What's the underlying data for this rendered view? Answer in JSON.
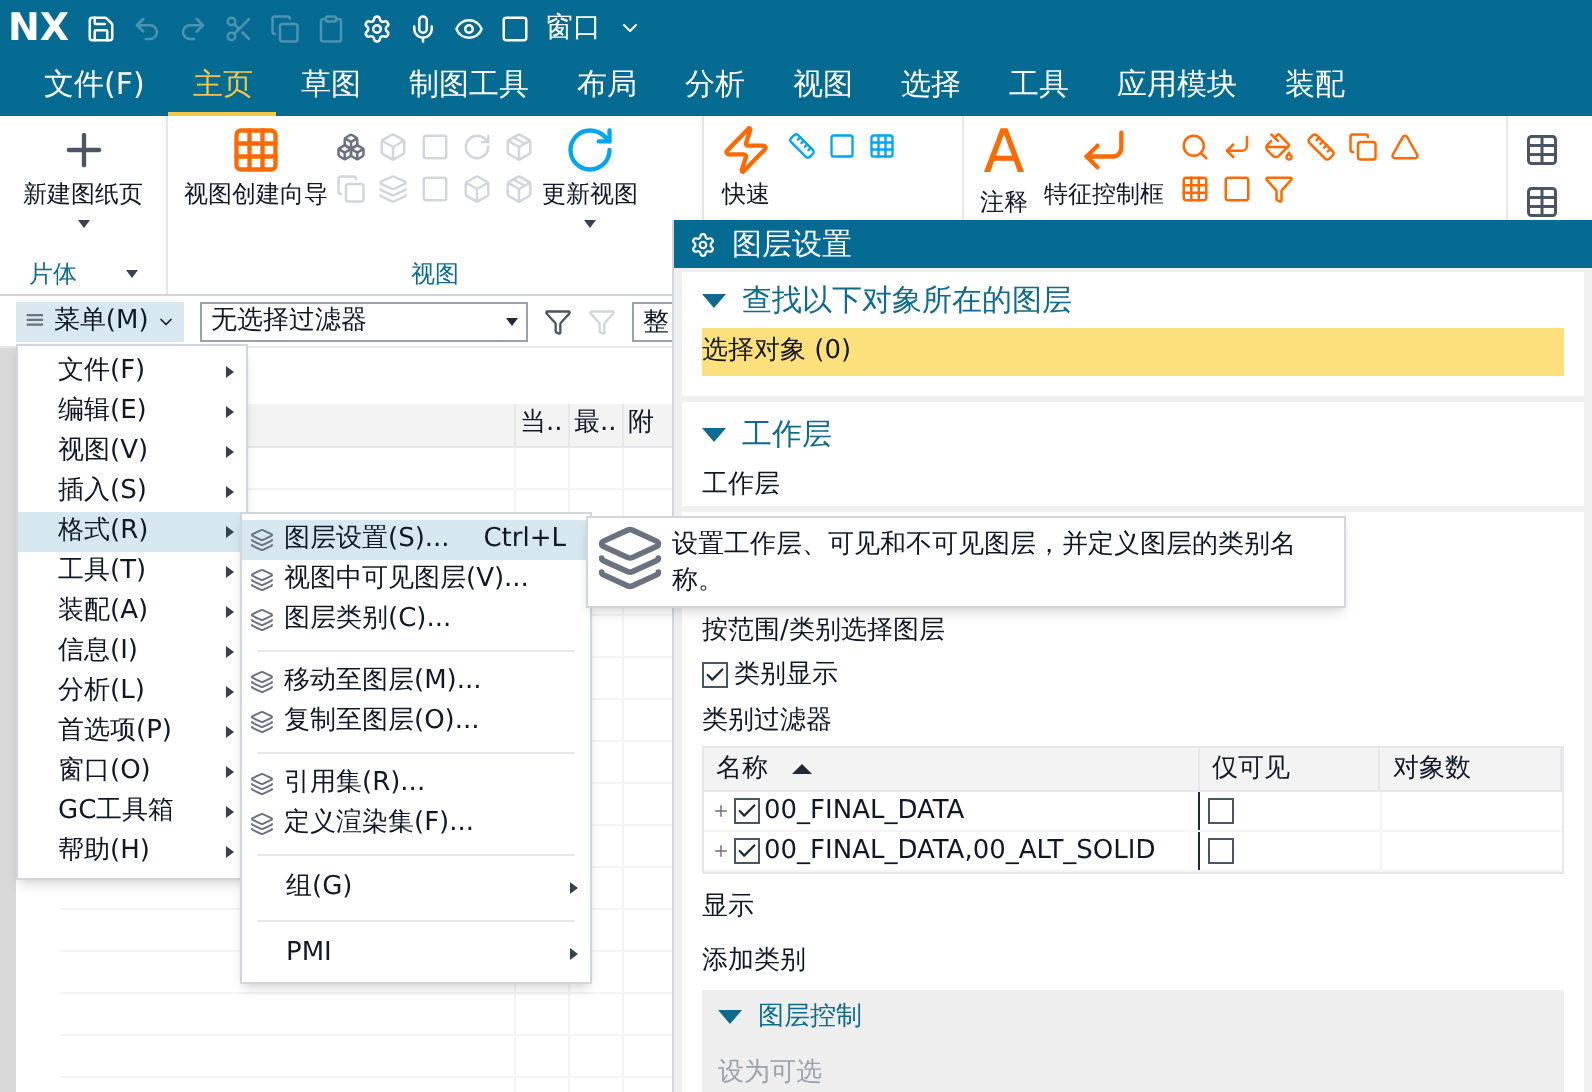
{
  "title_bar": {
    "logo": "NX",
    "window_menu": "窗口"
  },
  "tabs": [
    {
      "label": "文件(F)",
      "selected": false
    },
    {
      "label": "主页",
      "selected": true
    },
    {
      "label": "草图",
      "selected": false
    },
    {
      "label": "制图工具",
      "selected": false
    },
    {
      "label": "布局",
      "selected": false
    },
    {
      "label": "分析",
      "selected": false
    },
    {
      "label": "视图",
      "selected": false
    },
    {
      "label": "选择",
      "selected": false
    },
    {
      "label": "工具",
      "selected": false
    },
    {
      "label": "应用模块",
      "selected": false
    },
    {
      "label": "装配",
      "selected": false
    }
  ],
  "ribbon": {
    "sheet_group": {
      "label": "片体",
      "button": "新建图纸页"
    },
    "view_group": {
      "label": "视图",
      "wizard_button": "视图创建向导",
      "update_button": "更新视图"
    },
    "quick_button": "快速",
    "note_glyph": "A",
    "note_button": "注释",
    "fcf_button": "特征控制框"
  },
  "toolbar": {
    "menu_glyph": "≡",
    "menu_button": "菜单(M)",
    "filter": "无选择过滤器",
    "scope_field": "整"
  },
  "canvas_table": {
    "columns": [
      "当..",
      "最..",
      "附"
    ]
  },
  "main_menu": {
    "items": [
      {
        "label": "文件(F)",
        "selected": false
      },
      {
        "label": "编辑(E)",
        "selected": false
      },
      {
        "label": "视图(V)",
        "selected": false
      },
      {
        "label": "插入(S)",
        "selected": false
      },
      {
        "label": "格式(R)",
        "selected": true
      },
      {
        "label": "工具(T)",
        "selected": false
      },
      {
        "label": "装配(A)",
        "selected": false
      },
      {
        "label": "信息(I)",
        "selected": false
      },
      {
        "label": "分析(L)",
        "selected": false
      },
      {
        "label": "首选项(P)",
        "selected": false
      },
      {
        "label": "窗口(O)",
        "selected": false
      },
      {
        "label": "GC工具箱",
        "selected": false
      },
      {
        "label": "帮助(H)",
        "selected": false
      }
    ]
  },
  "format_submenu": {
    "items": [
      {
        "kind": "command",
        "label": "图层设置(S)...",
        "shortcut": "Ctrl+L",
        "selected": true
      },
      {
        "kind": "command",
        "label": "视图中可见图层(V)...",
        "selected": false
      },
      {
        "kind": "command",
        "label": "图层类别(C)...",
        "selected": false
      },
      {
        "kind": "divider"
      },
      {
        "kind": "command",
        "label": "移动至图层(M)...",
        "selected": false
      },
      {
        "kind": "command",
        "label": "复制至图层(O)...",
        "selected": false
      },
      {
        "kind": "divider"
      },
      {
        "kind": "command",
        "label": "引用集(R)...",
        "selected": false
      },
      {
        "kind": "command",
        "label": "定义渲染集(F)...",
        "selected": false
      },
      {
        "kind": "divider"
      },
      {
        "kind": "submenu",
        "label": "组(G)",
        "selected": false
      },
      {
        "kind": "divider"
      },
      {
        "kind": "submenu",
        "label": "PMI",
        "selected": false
      }
    ]
  },
  "tooltip": {
    "text": "设置工作层、可见和不可见图层，并定义图层的类别名称。"
  },
  "dialog": {
    "title": "图层设置",
    "find_section": {
      "title": "查找以下对象所在的图层",
      "expanded": true,
      "select_row": "选择对象 (0)"
    },
    "work_section": {
      "title": "工作层",
      "expanded": true,
      "label": "工作层"
    },
    "layers_label": "按范围/类别选择图层",
    "category_display": {
      "label": "类别显示",
      "checked": true
    },
    "filter_label": "类别过滤器",
    "table": {
      "columns": [
        "名称",
        "仅可见",
        "对象数"
      ],
      "rows": [
        {
          "name": "00_FINAL_DATA",
          "checked": true,
          "visible_only": false
        },
        {
          "name": "00_FINAL_DATA,00_ALT_SOLID",
          "checked": true,
          "visible_only": false
        }
      ]
    },
    "display_label": "显示",
    "add_category_label": "添加类别",
    "layer_control": {
      "title": "图层控制",
      "expanded": true,
      "action": "设为可选",
      "action_disabled": true
    }
  }
}
